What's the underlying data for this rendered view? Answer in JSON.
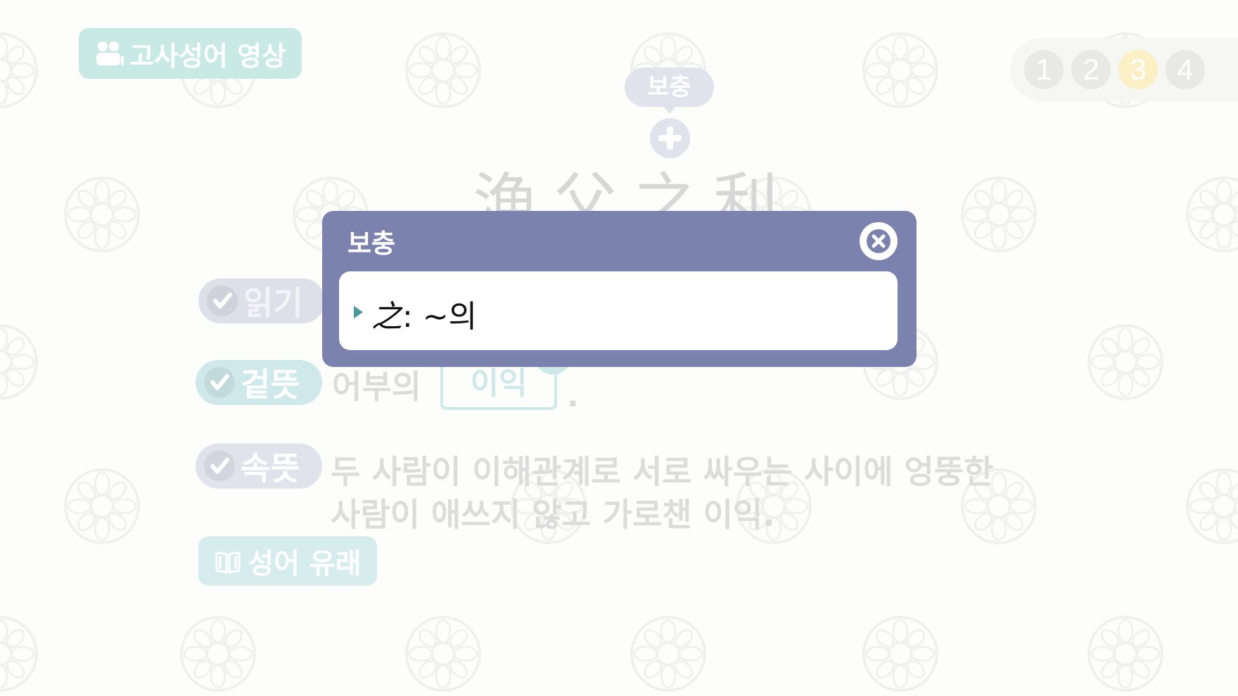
{
  "header": {
    "video_button_label": "고사성어 영상",
    "video_icon": "people-icon"
  },
  "pager": {
    "pages": [
      "1",
      "2",
      "3",
      "4"
    ],
    "active_page": "3"
  },
  "supplement": {
    "tag_label": "보충",
    "plus_icon": "plus-icon"
  },
  "idiom": {
    "hanja": "漁父之利"
  },
  "rows": {
    "reading": {
      "label": "읽기"
    },
    "surface": {
      "label": "겉뜻",
      "text_before": "어부의",
      "answer": "이익",
      "text_after": "."
    },
    "inner": {
      "label": "속뜻",
      "line1": "두 사람이 이해관계로 서로 싸우는 사이에 엉뚱한",
      "line2": "사람이 애쓰지 않고 가로챈 이익."
    }
  },
  "origin_button": {
    "label": "성어 유래",
    "icon": "book-icon"
  },
  "popup": {
    "title": "보충",
    "close_icon": "close-icon",
    "item_hanja": "之",
    "item_text": ": ~의"
  },
  "colors": {
    "popup_header": "#7c82ae",
    "teal_accent": "#4a97a0",
    "mint": "#cfe8ea",
    "lavender": "#e2e2ed",
    "active_page": "#fbefc6"
  }
}
